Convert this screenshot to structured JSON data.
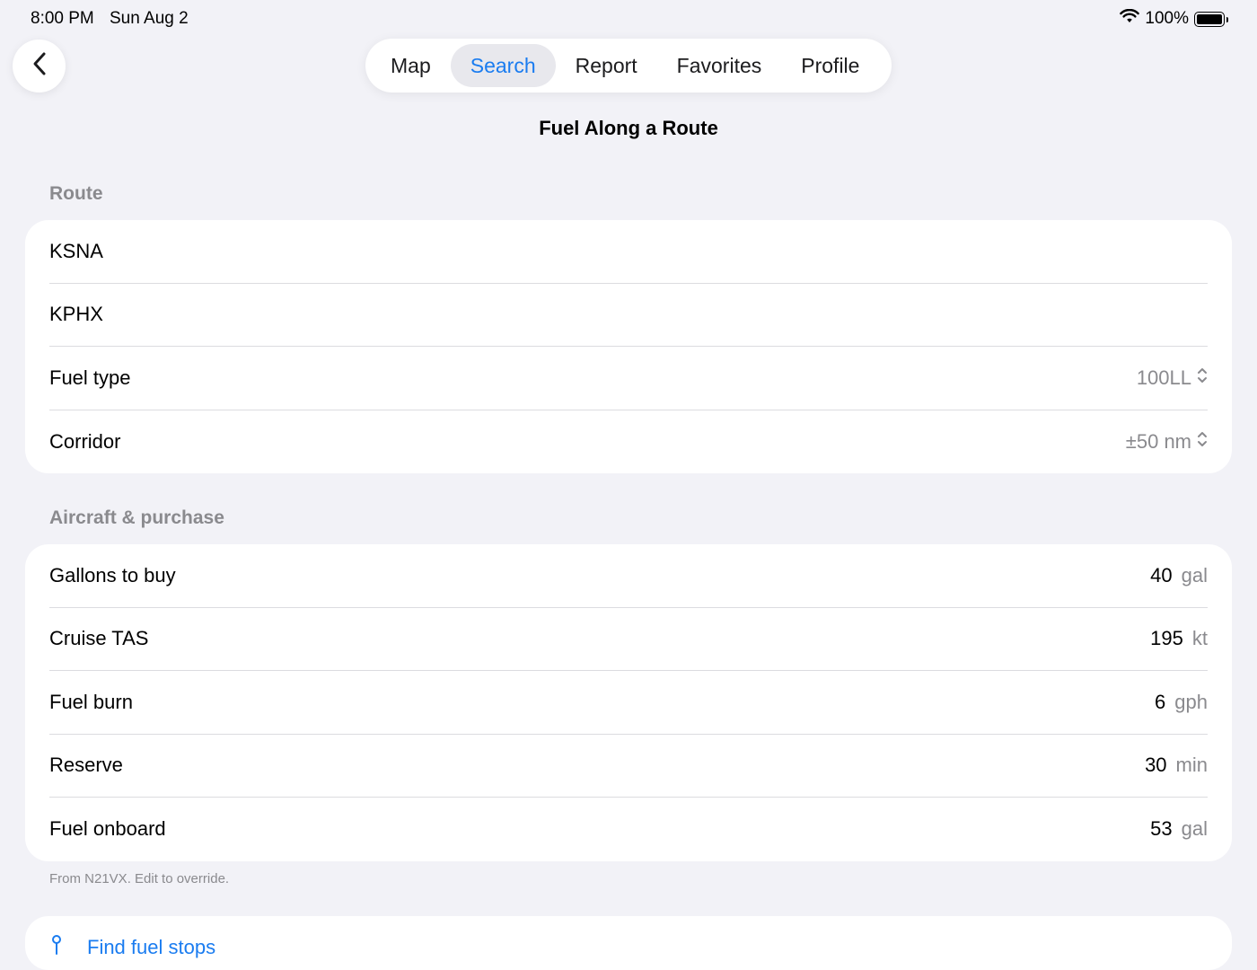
{
  "status": {
    "time": "8:00 PM",
    "date": "Sun Aug 2",
    "battery": "100%"
  },
  "tabs": [
    "Map",
    "Search",
    "Report",
    "Favorites",
    "Profile"
  ],
  "active_tab": "Search",
  "title": "Fuel Along a Route",
  "route": {
    "header": "Route",
    "origin": "KSNA",
    "destination": "KPHX",
    "fuel_type_label": "Fuel type",
    "fuel_type_value": "100LL",
    "corridor_label": "Corridor",
    "corridor_value": "±50 nm"
  },
  "aircraft": {
    "header": "Aircraft & purchase",
    "rows": [
      {
        "label": "Gallons to buy",
        "value": "40",
        "unit": "gal"
      },
      {
        "label": "Cruise TAS",
        "value": "195",
        "unit": "kt"
      },
      {
        "label": "Fuel burn",
        "value": "6",
        "unit": "gph"
      },
      {
        "label": "Reserve",
        "value": "30",
        "unit": "min"
      },
      {
        "label": "Fuel onboard",
        "value": "53",
        "unit": "gal"
      }
    ],
    "footnote": "From N21VX. Edit to override."
  },
  "action": {
    "label": "Find fuel stops"
  },
  "colors": {
    "accent": "#1a7cf0",
    "secondary": "#8a8a8e",
    "background": "#f2f2f7"
  }
}
